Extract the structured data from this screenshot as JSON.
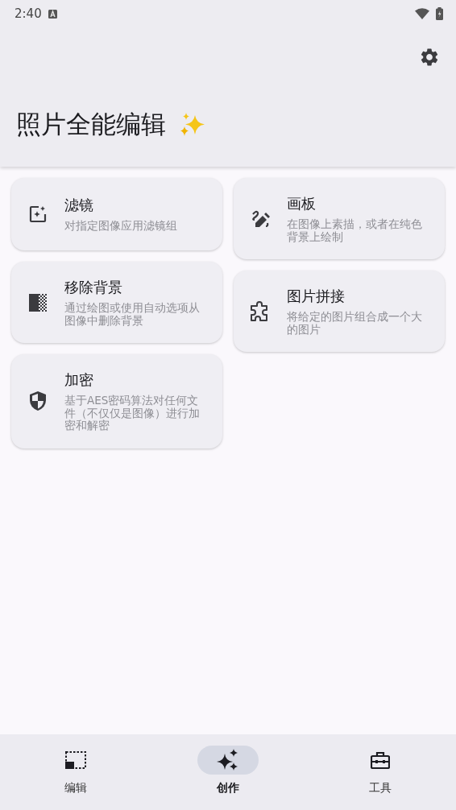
{
  "status_bar": {
    "time": "2:40"
  },
  "app_bar": {
    "title": "照片全能编辑"
  },
  "columns": [
    [
      {
        "kind": "filter",
        "title": "滤镜",
        "description": "对指定图像应用滤镜组"
      },
      {
        "kind": "erase",
        "title": "移除背景",
        "description": "通过绘图或使用自动选项从图像中删除背景"
      },
      {
        "kind": "encrypt",
        "title": "加密",
        "description": "基于AES密码算法对任何文件（不仅仅是图像）进行加密和解密"
      }
    ],
    [
      {
        "kind": "draw",
        "title": "画板",
        "description": "在图像上素描，或者在纯色背景上绘制"
      },
      {
        "kind": "collage",
        "title": "图片拼接",
        "description": "将给定的图片组合成一个大的图片"
      }
    ]
  ],
  "bottom_nav": [
    {
      "kind": "edit",
      "label": "编辑",
      "selected": false
    },
    {
      "kind": "create",
      "label": "创作",
      "selected": true
    },
    {
      "kind": "tools",
      "label": "工具",
      "selected": false
    }
  ]
}
